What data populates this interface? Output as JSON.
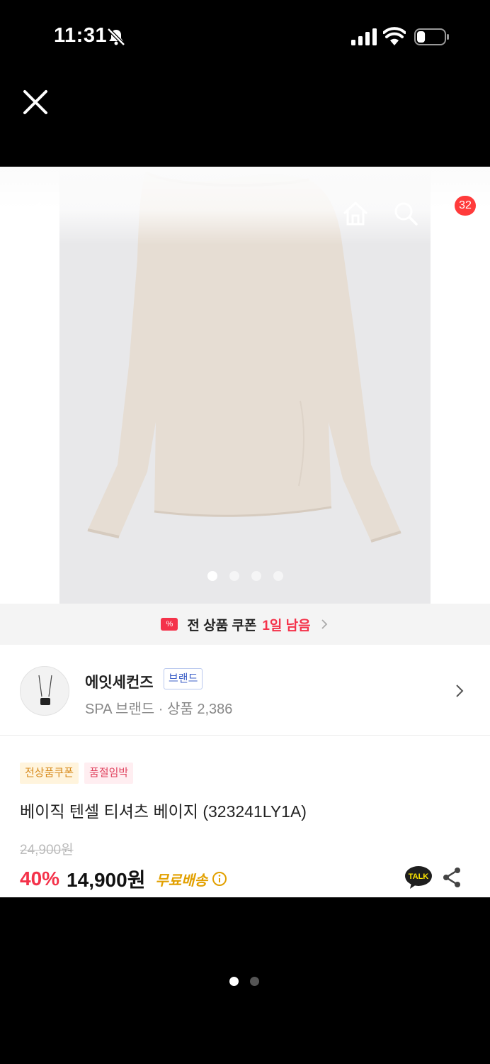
{
  "status_bar": {
    "time": "11:31",
    "battery_level": 0.3
  },
  "gallery": {
    "current_index": 1,
    "image_count": 4
  },
  "header": {
    "cart_count": "32"
  },
  "coupon_banner": {
    "text": "전 상품 쿠폰",
    "days_left": "1일 남음"
  },
  "brand": {
    "name": "에잇세컨즈",
    "badge": "브랜드",
    "meta": "SPA 브랜드 · 상품 2,386"
  },
  "product": {
    "tags": [
      "전상품쿠폰",
      "품절임박"
    ],
    "title": "베이직 텐셀 티셔츠  베이지 (323241LY1A)",
    "original_price": "24,900원",
    "discount": "40%",
    "price": "14,900원",
    "shipping": "무료배송"
  },
  "pager": {
    "current_page": 1,
    "page_count": 2
  },
  "colors": {
    "accent_red": "#f4324a",
    "shipping_yellow": "#e2a000",
    "brand_blue": "#3c5fc7",
    "product_beige": "#e6ddd3"
  }
}
